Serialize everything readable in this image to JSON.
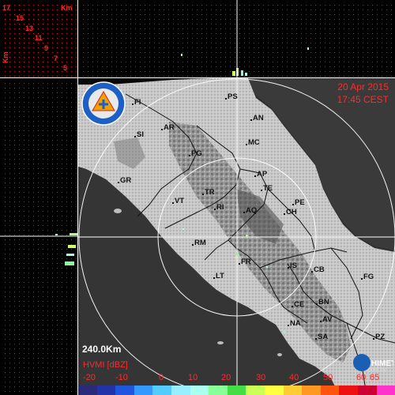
{
  "height_axis": {
    "unit_top": "Km",
    "unit_side": "Km",
    "ticks": [
      "17",
      "15",
      "13",
      "11",
      "9",
      "7",
      "5"
    ]
  },
  "timestamp": {
    "date": "20 Apr 2015",
    "time": "17:45 CEST"
  },
  "range": "240.0Km",
  "cities": [
    "PS",
    "FI",
    "AN",
    "AR",
    "SI",
    "MC",
    "PG",
    "GR",
    "AP",
    "TE",
    "TR",
    "PE",
    "RI",
    "VT",
    "AQ",
    "CH",
    "RM",
    "FR",
    "IS",
    "CB",
    "FG",
    "LT",
    "CE",
    "BN",
    "NA",
    "AV",
    "SA",
    "PZ"
  ],
  "legend": {
    "title": "HVMI [dBZ]",
    "ticks": [
      "-20",
      "-10",
      "0",
      "10",
      "20",
      "30",
      "40",
      "50",
      "60",
      "65"
    ],
    "colors": [
      "#2a2a7a",
      "#2233aa",
      "#2255dd",
      "#3399ff",
      "#55ccff",
      "#99eeff",
      "#aaffee",
      "#88ff99",
      "#44dd44",
      "#ccff55",
      "#ffff44",
      "#ffcc33",
      "#ff9922",
      "#ff5511",
      "#ee1111",
      "#cc0033",
      "#ff33cc"
    ]
  },
  "branding": {
    "powered_by": "Powered by",
    "logo_text": "HIMET"
  },
  "accent_color": "#ff2a2a"
}
